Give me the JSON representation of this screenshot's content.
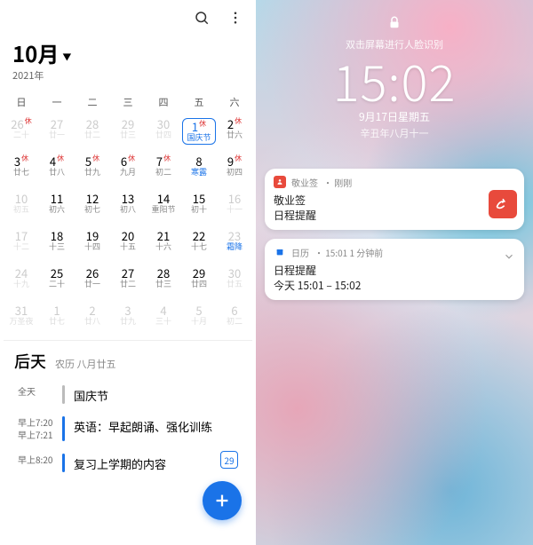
{
  "left": {
    "month_label": "10月",
    "year_label": "2021年",
    "weekdays": [
      "日",
      "一",
      "二",
      "三",
      "四",
      "五",
      "六"
    ],
    "grid": [
      [
        {
          "g": "26",
          "l": "二十",
          "dim": true,
          "holiday": true
        },
        {
          "g": "27",
          "l": "廿一",
          "dim": true
        },
        {
          "g": "28",
          "l": "廿二",
          "dim": true
        },
        {
          "g": "29",
          "l": "廿三",
          "dim": true
        },
        {
          "g": "30",
          "l": "廿四",
          "dim": true
        },
        {
          "g": "1",
          "l": "国庆节",
          "holiday": true,
          "selected": true
        },
        {
          "g": "2",
          "l": "廿六",
          "holiday": true
        }
      ],
      [
        {
          "g": "3",
          "l": "廿七",
          "holiday": true
        },
        {
          "g": "4",
          "l": "廿八",
          "holiday": true
        },
        {
          "g": "5",
          "l": "廿九",
          "holiday": true
        },
        {
          "g": "6",
          "l": "九月",
          "holiday": true
        },
        {
          "g": "7",
          "l": "初二",
          "holiday": true
        },
        {
          "g": "8",
          "l": "寒露",
          "blue": true
        },
        {
          "g": "9",
          "l": "初四",
          "holiday": true
        }
      ],
      [
        {
          "g": "10",
          "l": "初五",
          "dim": true
        },
        {
          "g": "11",
          "l": "初六"
        },
        {
          "g": "12",
          "l": "初七"
        },
        {
          "g": "13",
          "l": "初八"
        },
        {
          "g": "14",
          "l": "重阳节"
        },
        {
          "g": "15",
          "l": "初十"
        },
        {
          "g": "16",
          "l": "十一",
          "dim": true
        }
      ],
      [
        {
          "g": "17",
          "l": "十二",
          "dim": true
        },
        {
          "g": "18",
          "l": "十三"
        },
        {
          "g": "19",
          "l": "十四"
        },
        {
          "g": "20",
          "l": "十五"
        },
        {
          "g": "21",
          "l": "十六"
        },
        {
          "g": "22",
          "l": "十七"
        },
        {
          "g": "23",
          "l": "霜降",
          "dim": true,
          "blue": true
        }
      ],
      [
        {
          "g": "24",
          "l": "十九",
          "dim": true
        },
        {
          "g": "25",
          "l": "二十"
        },
        {
          "g": "26",
          "l": "廿一"
        },
        {
          "g": "27",
          "l": "廿二"
        },
        {
          "g": "28",
          "l": "廿三"
        },
        {
          "g": "29",
          "l": "廿四"
        },
        {
          "g": "30",
          "l": "廿五",
          "dim": true
        }
      ],
      [
        {
          "g": "31",
          "l": "万圣夜",
          "dim": true
        },
        {
          "g": "1",
          "l": "廿七",
          "dim": true
        },
        {
          "g": "2",
          "l": "廿八",
          "dim": true
        },
        {
          "g": "3",
          "l": "廿九",
          "dim": true
        },
        {
          "g": "4",
          "l": "三十",
          "dim": true
        },
        {
          "g": "5",
          "l": "十月",
          "dim": true
        },
        {
          "g": "6",
          "l": "初二",
          "dim": true
        }
      ]
    ],
    "today": {
      "label": "后天",
      "sub": "农历 八月廿五",
      "allday_label": "全天",
      "allday_item": "国庆节"
    },
    "events": [
      {
        "t1": "早上7:20",
        "t2": "早上7:21",
        "title": "英语：早起朗诵、强化训练"
      },
      {
        "t1": "早上8:20",
        "t2": "",
        "title": "复习上学期的内容"
      }
    ],
    "badge": "29"
  },
  "right": {
    "hint": "双击屏幕进行人脸识别",
    "time": "15:02",
    "date": "9月17日星期五",
    "date2": "辛丑年八月十一",
    "notifs": [
      {
        "app": "敬业签",
        "when": "刚刚",
        "title": "敬业签",
        "sub": "日程提醒",
        "big_icon": true
      },
      {
        "app": "日历",
        "when": "15:01  1 分钟前",
        "title": "日程提醒",
        "sub": "今天 15:01 – 15:02",
        "chevron": true
      }
    ]
  }
}
